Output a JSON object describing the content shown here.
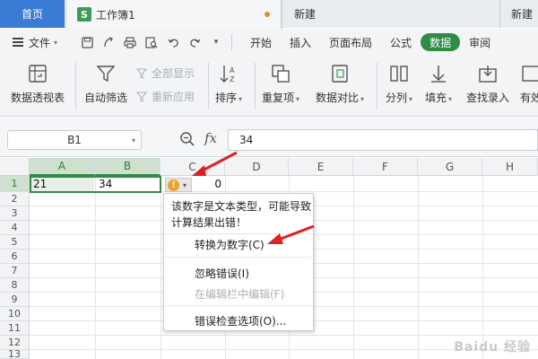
{
  "tabs": {
    "home": "首页",
    "doc": {
      "icon": "S",
      "title": "工作簿1"
    },
    "new1": "新建",
    "new2": "新建"
  },
  "menu": {
    "file": "文件",
    "tabs": [
      "开始",
      "插入",
      "页面布局",
      "公式",
      "数据",
      "审阅"
    ],
    "active": "数据"
  },
  "ribbon": {
    "pivot": "数据透视表",
    "autofilter": "自动筛选",
    "show_all": "全部显示",
    "reapply": "重新应用",
    "sort": "排序",
    "duplicates": "重复项",
    "compare": "数据对比",
    "split": "分列",
    "fill": "填充",
    "lookup": "查找录入",
    "valid": "有效"
  },
  "formula_bar": {
    "name_box": "B1",
    "fx": "fx",
    "value": "34"
  },
  "columns": [
    "A",
    "B",
    "C",
    "D",
    "E",
    "F",
    "G",
    "H"
  ],
  "rows": [
    "1",
    "2",
    "3",
    "4",
    "5",
    "6",
    "7",
    "8",
    "9",
    "10",
    "11",
    "12",
    "13"
  ],
  "cells": {
    "A1": "21",
    "B1": "34",
    "C1": "0"
  },
  "error_menu": {
    "message": "该数字是文本类型，可能导致计算结果出错！",
    "convert": "转换为数字(C)",
    "ignore": "忽略错误(I)",
    "edit_in_bar": "在编辑栏中编辑(F)",
    "options": "错误检查选项(O)..."
  },
  "watermark": "Baidu 经验",
  "colors": {
    "accent": "#2e8c46",
    "home_tab": "#3a7bd5",
    "warning": "#f0a22b",
    "arrow": "#e02020"
  }
}
